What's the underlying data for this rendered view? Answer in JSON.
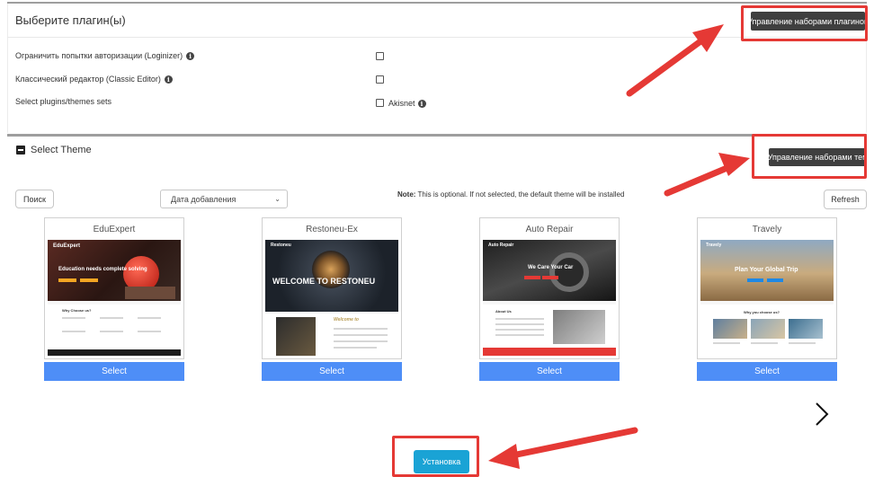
{
  "plugins": {
    "title": "Выберите плагин(ы)",
    "manage_button": "Управление наборами плагинов",
    "rows": [
      {
        "label": "Ограничить попытки авторизации (Loginizer)"
      },
      {
        "label": "Классический редактор (Classic Editor)"
      },
      {
        "label": "Select plugins/themes sets"
      }
    ],
    "akismet_label": "Akisnet"
  },
  "theme": {
    "title": "Select Theme",
    "manage_button": "Управление наборами тем",
    "search_button": "Поиск",
    "sort_select": "Дата добавления",
    "note_bold": "Note:",
    "note_text": " This is optional. If not selected, the default theme will be installed",
    "refresh_button": "Refresh",
    "cards": [
      {
        "name": "EduExpert",
        "select": "Select",
        "thumb_title": "Education needs complete solving",
        "thumb_brand": "EduExpert",
        "thumb_sub": "Why Choose us?"
      },
      {
        "name": "Restoneu-Ex",
        "select": "Select",
        "thumb_title": "WELCOME TO RESTONEU",
        "thumb_brand": "Restoneu",
        "thumb_sub": "Welcome to"
      },
      {
        "name": "Auto Repair",
        "select": "Select",
        "thumb_title": "We Care Your Car",
        "thumb_brand": "Auto Repair",
        "thumb_sub": "About Us"
      },
      {
        "name": "Travely",
        "select": "Select",
        "thumb_title": "Plan Your Global Trip",
        "thumb_brand": "Travely",
        "thumb_sub": "Why you choose us?"
      }
    ]
  },
  "install_button": "Установка",
  "icons": {
    "info": "info-circle-icon",
    "minus": "minus-square-icon",
    "next": "chevron-right-icon",
    "sort": "chevron-down-icon"
  },
  "colors": {
    "select_blue": "#4e8ef7",
    "install_blue": "#1aa3d5",
    "annotation_red": "#e53935",
    "dark_button": "#3f3f3f"
  }
}
